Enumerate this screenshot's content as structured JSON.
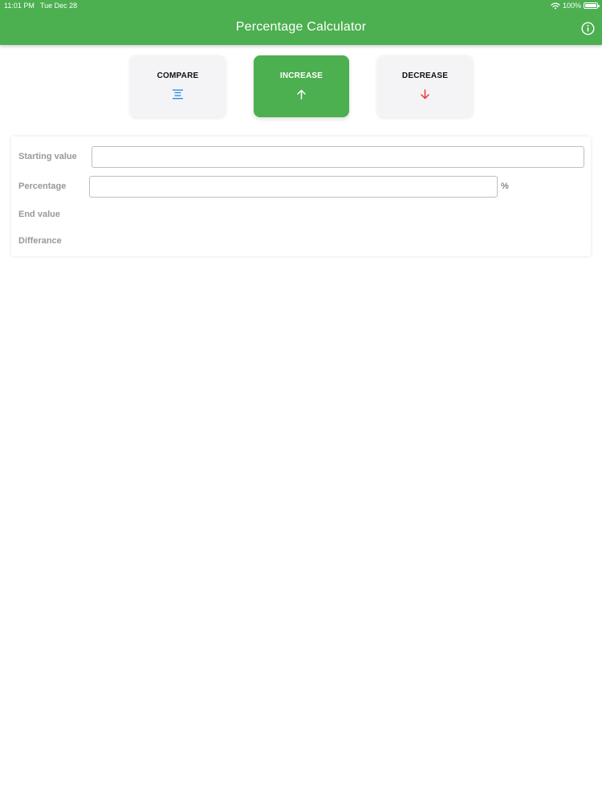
{
  "status_bar": {
    "time": "11:01 PM",
    "date": "Tue Dec 28",
    "battery": "100%"
  },
  "header": {
    "title": "Percentage Calculator",
    "info_icon": "info-circle-icon"
  },
  "modes": [
    {
      "label": "COMPARE",
      "icon": "align-center-icon",
      "icon_color": "#1e88e5",
      "active": false
    },
    {
      "label": "INCREASE",
      "icon": "arrow-up-icon",
      "icon_color": "#ffffff",
      "active": true
    },
    {
      "label": "DECREASE",
      "icon": "arrow-down-icon",
      "icon_color": "#e53935",
      "active": false
    }
  ],
  "form": {
    "starting_value": {
      "label": "Starting value",
      "value": "",
      "placeholder": ""
    },
    "percentage": {
      "label": "Percentage",
      "value": "",
      "placeholder": "",
      "unit": "%"
    },
    "end_value": {
      "label": "End value",
      "value": ""
    },
    "difference": {
      "label": "Differance",
      "value": ""
    }
  },
  "colors": {
    "accent": "#4caf50",
    "inactive_button": "#f4f4f6",
    "label": "#999999"
  }
}
